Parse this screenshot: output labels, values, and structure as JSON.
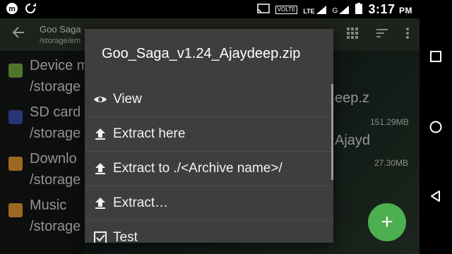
{
  "status_bar": {
    "badge_volte": "VOLTE",
    "badge_lte": "LTE",
    "network_g": "G",
    "time": "3:17",
    "ampm": "PM"
  },
  "toolbar": {
    "title": "Goo Saga",
    "subtitle": "/storage/em"
  },
  "sidebar": {
    "items": [
      {
        "name": "Device m",
        "path": "/storage",
        "icon": "android-icon",
        "color": "#7cb342"
      },
      {
        "name": "SD card",
        "path": "/storage",
        "icon": "sd-card-icon",
        "color": "#3f51b5"
      },
      {
        "name": "Downlo",
        "path": "/storage",
        "icon": "download-folder-icon",
        "color": "#f0a030"
      },
      {
        "name": "Music",
        "path": "/storage",
        "icon": "music-folder-icon",
        "color": "#f0a030"
      }
    ]
  },
  "background_files": [
    {
      "name": "eep.z",
      "size": "151.29MB"
    },
    {
      "name": "Ajayd",
      "size": "27.30MB"
    }
  ],
  "menu": {
    "title": "Goo_Saga_v1.24_Ajaydeep.zip",
    "items": [
      {
        "label": "View",
        "icon": "eye-icon"
      },
      {
        "label": "Extract here",
        "icon": "upload-icon"
      },
      {
        "label": "Extract to ./<Archive name>/",
        "icon": "upload-icon"
      },
      {
        "label": "Extract…",
        "icon": "upload-icon"
      },
      {
        "label": "Test",
        "icon": "checkbox-icon"
      }
    ]
  },
  "fab": {
    "label": "+"
  },
  "colors": {
    "toolbar": "#2d3529",
    "menu_bg": "#3e3e3e",
    "fab": "#4caf50"
  }
}
